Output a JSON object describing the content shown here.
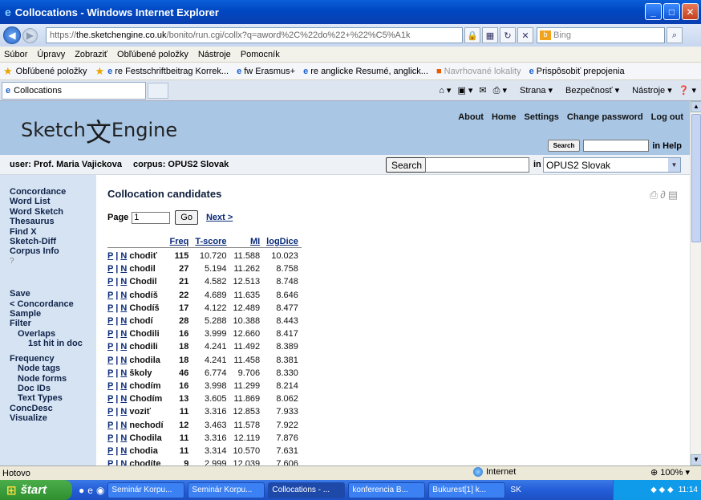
{
  "window": {
    "title": "Collocations - Windows Internet Explorer"
  },
  "address": {
    "url_prefix": "https://",
    "url_host": "the.sketchengine.co.uk",
    "url_rest": "/bonito/run.cgi/collx?q=aword%2C%22do%22+%22%C5%A1k",
    "search_placeholder": "Bing"
  },
  "menu": [
    "Súbor",
    "Úpravy",
    "Zobraziť",
    "Obľúbené položky",
    "Nástroje",
    "Pomocník"
  ],
  "favorites": {
    "label": "Obľúbené položky",
    "items": [
      "re Festschriftbeitrag Korrek...",
      "fw Erasmus+",
      "re anglicke Resumé, anglick...",
      "Navrhované lokality",
      "Prispôsobiť prepojenia"
    ]
  },
  "tab": {
    "label": "Collocations"
  },
  "commandbar": {
    "page": "Strana",
    "safety": "Bezpečnosť",
    "tools": "Nástroje"
  },
  "site": {
    "logo_left": "Sketch",
    "logo_glyph": "文",
    "logo_right": "Engine",
    "toplinks": [
      "About",
      "Home",
      "Settings",
      "Change password",
      "Log out"
    ],
    "help_search_button": "Search",
    "help_label": "in Help"
  },
  "userbar": {
    "user": "user: Prof. Maria Vajickova",
    "corpus": "corpus: OPUS2 Slovak",
    "search_button": "Search",
    "in_label": "in",
    "corpus_select": "OPUS2 Slovak"
  },
  "sidebar": {
    "main": [
      "Concordance",
      "Word List",
      "Word Sketch",
      "Thesaurus",
      "Find X",
      "Sketch-Diff",
      "Corpus Info"
    ],
    "help": "?",
    "actions": [
      "Save",
      "< Concordance",
      "Sample",
      "Filter"
    ],
    "filter_sub": [
      "Overlaps",
      "1st hit in doc"
    ],
    "frequency": "Frequency",
    "frequency_sub": [
      "Node tags",
      "Node forms",
      "Doc IDs",
      "Text Types"
    ],
    "more": [
      "ConcDesc",
      "Visualize"
    ]
  },
  "main": {
    "title": "Collocation candidates",
    "page_label": "Page",
    "page_value": "1",
    "go": "Go",
    "next": "Next >",
    "columns": [
      "Freq",
      "T-score",
      "MI",
      "logDice"
    ],
    "rows": [
      {
        "p": "P",
        "n": "N",
        "word": "chodiť",
        "freq": "115",
        "tscore": "10.720",
        "mi": "11.588",
        "logdice": "10.023"
      },
      {
        "p": "P",
        "n": "N",
        "word": "chodil",
        "freq": "27",
        "tscore": "5.194",
        "mi": "11.262",
        "logdice": "8.758"
      },
      {
        "p": "P",
        "n": "N",
        "word": "Chodil",
        "freq": "21",
        "tscore": "4.582",
        "mi": "12.513",
        "logdice": "8.748"
      },
      {
        "p": "P",
        "n": "N",
        "word": "chodíš",
        "freq": "22",
        "tscore": "4.689",
        "mi": "11.635",
        "logdice": "8.646"
      },
      {
        "p": "P",
        "n": "N",
        "word": "Chodíš",
        "freq": "17",
        "tscore": "4.122",
        "mi": "12.489",
        "logdice": "8.477"
      },
      {
        "p": "P",
        "n": "N",
        "word": "chodí",
        "freq": "28",
        "tscore": "5.288",
        "mi": "10.388",
        "logdice": "8.443"
      },
      {
        "p": "P",
        "n": "N",
        "word": "Chodili",
        "freq": "16",
        "tscore": "3.999",
        "mi": "12.660",
        "logdice": "8.417"
      },
      {
        "p": "P",
        "n": "N",
        "word": "chodili",
        "freq": "18",
        "tscore": "4.241",
        "mi": "11.492",
        "logdice": "8.389"
      },
      {
        "p": "P",
        "n": "N",
        "word": "chodila",
        "freq": "18",
        "tscore": "4.241",
        "mi": "11.458",
        "logdice": "8.381"
      },
      {
        "p": "P",
        "n": "N",
        "word": "školy",
        "freq": "46",
        "tscore": "6.774",
        "mi": "9.706",
        "logdice": "8.330"
      },
      {
        "p": "P",
        "n": "N",
        "word": "chodím",
        "freq": "16",
        "tscore": "3.998",
        "mi": "11.299",
        "logdice": "8.214"
      },
      {
        "p": "P",
        "n": "N",
        "word": "Chodím",
        "freq": "13",
        "tscore": "3.605",
        "mi": "11.869",
        "logdice": "8.062"
      },
      {
        "p": "P",
        "n": "N",
        "word": "voziť",
        "freq": "11",
        "tscore": "3.316",
        "mi": "12.853",
        "logdice": "7.933"
      },
      {
        "p": "P",
        "n": "N",
        "word": "nechodí",
        "freq": "12",
        "tscore": "3.463",
        "mi": "11.578",
        "logdice": "7.922"
      },
      {
        "p": "P",
        "n": "N",
        "word": "Chodila",
        "freq": "11",
        "tscore": "3.316",
        "mi": "12.119",
        "logdice": "7.876"
      },
      {
        "p": "P",
        "n": "N",
        "word": "chodia",
        "freq": "11",
        "tscore": "3.314",
        "mi": "10.570",
        "logdice": "7.631"
      },
      {
        "p": "P",
        "n": "N",
        "word": "chodíte",
        "freq": "9",
        "tscore": "2.999",
        "mi": "12.039",
        "logdice": "7.606"
      }
    ]
  },
  "status": {
    "left": "Hotovo",
    "zone": "Internet",
    "zoom": "100%"
  },
  "taskbar": {
    "start": "štart",
    "tasks": [
      "Seminár Korpu...",
      "Seminár Korpu...",
      "Collocations - ...",
      "konferencia B...",
      "Bukurest[1] k..."
    ],
    "lang": "SK",
    "clock": "11:14"
  },
  "colors": {
    "header_bg": "#a9c6e5",
    "sidebar_bg": "#d6e3f2",
    "link": "#0a2a7a"
  }
}
